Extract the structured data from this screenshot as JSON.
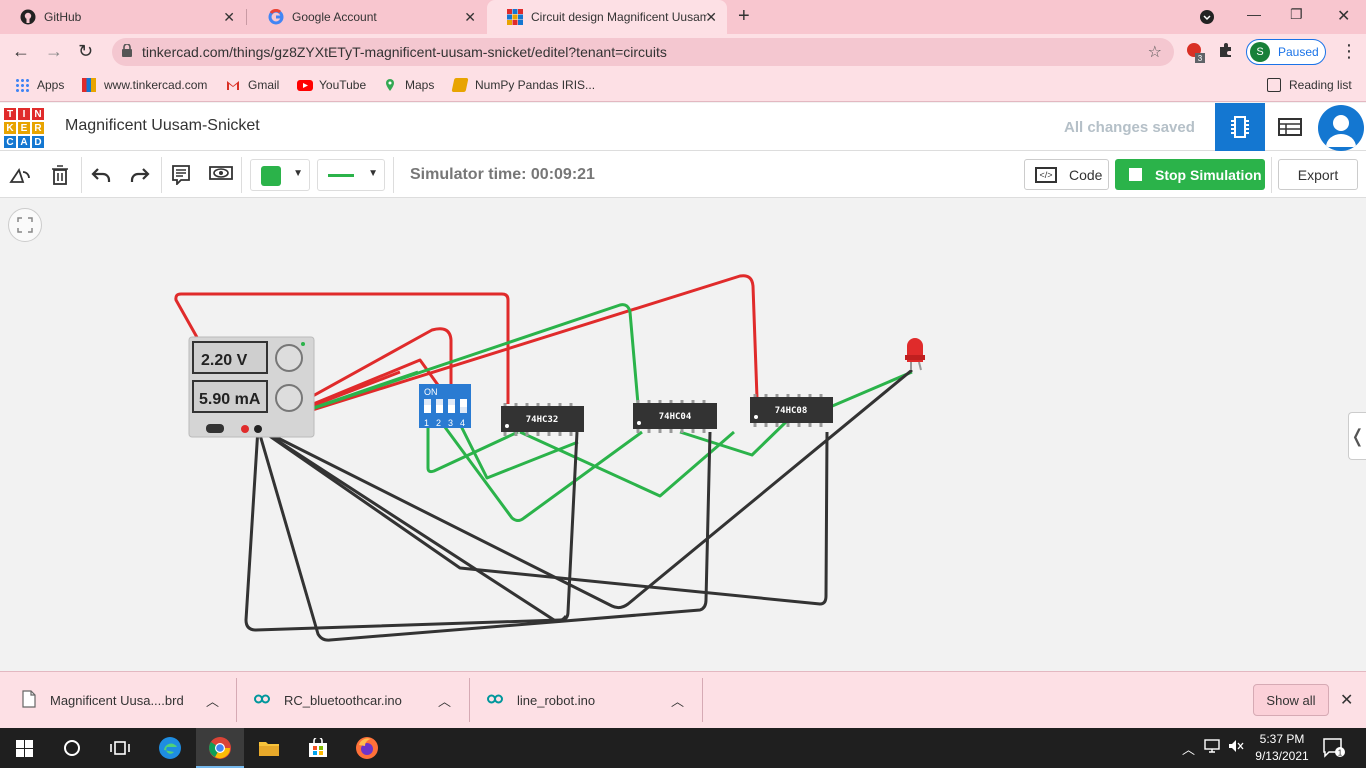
{
  "browser": {
    "tabs": [
      {
        "title": "GitHub",
        "active": false
      },
      {
        "title": "Google Account",
        "active": false
      },
      {
        "title": "Circuit design Magnificent Uusam",
        "active": true
      }
    ],
    "url": "tinkercad.com/things/gz8ZYXtETyT-magnificent-uusam-snicket/editel?tenant=circuits",
    "extension_badge": "3",
    "profile_initial": "S",
    "profile_status": "Paused",
    "bookmarks": [
      "Apps",
      "www.tinkercad.com",
      "Gmail",
      "YouTube",
      "Maps",
      "NumPy Pandas IRIS..."
    ],
    "reading_list": "Reading list"
  },
  "app": {
    "logo_letters": [
      "T",
      "I",
      "N",
      "K",
      "E",
      "R",
      "C",
      "A",
      "D"
    ],
    "design_title": "Magnificent Uusam-Snicket",
    "save_status": "All changes saved"
  },
  "toolbar": {
    "simulator_time": "Simulator time: 00:09:21",
    "code_label": "Code",
    "code_icon_text": "</>",
    "stop_label": "Stop Simulation",
    "export_label": "Export",
    "wire_color": "#2bb34a"
  },
  "circuit": {
    "power_supply": {
      "voltage": "2.20 V",
      "current": "5.90 mA"
    },
    "dip_switch": {
      "label": "ON",
      "positions": [
        "1",
        "2",
        "3",
        "4"
      ]
    },
    "chips": [
      "74HC32",
      "74HC04",
      "74HC08"
    ],
    "colors": {
      "red": "#e02b2b",
      "green": "#2bb34a",
      "black": "#333333"
    }
  },
  "downloads": {
    "items": [
      "Magnificent Uusa....brd",
      "RC_bluetoothcar.ino",
      "line_robot.ino"
    ],
    "show_all": "Show all"
  },
  "taskbar": {
    "time": "5:37 PM",
    "date": "9/13/2021",
    "notifications": "1"
  }
}
